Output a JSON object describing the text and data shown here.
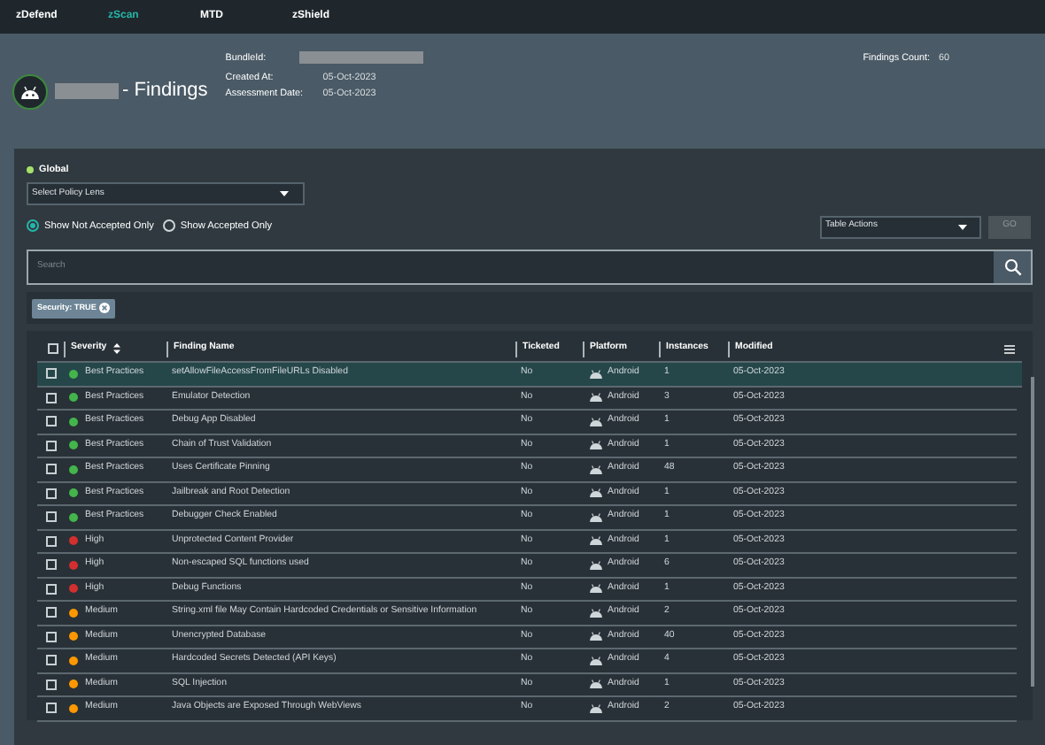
{
  "nav": [
    {
      "label": "zDefend",
      "selected": false
    },
    {
      "label": "zScan",
      "selected": true
    },
    {
      "label": "MTD",
      "selected": false
    },
    {
      "label": "zShield",
      "selected": false
    }
  ],
  "header": {
    "title": "- Findings",
    "meta": [
      {
        "label": "BundleId:",
        "value_redacted": true
      },
      {
        "label": "Created At:",
        "value": "05-Oct-2023"
      },
      {
        "label": "Assessment Date:",
        "value": "05-Oct-2023"
      }
    ],
    "findings_count_label": "Findings Count:",
    "findings_count": "60"
  },
  "scope": {
    "label": "Global",
    "color": "#a5e26a"
  },
  "policy_lens": {
    "placeholder": "Select Policy Lens"
  },
  "radios": [
    {
      "label": "Show Not Accepted Only",
      "selected": true
    },
    {
      "label": "Show Accepted Only",
      "selected": false
    }
  ],
  "table_actions": {
    "placeholder": "Table Actions"
  },
  "go_button": {
    "label": "GO",
    "disabled": true
  },
  "search": {
    "placeholder": "Search"
  },
  "filters": [
    {
      "label": "Security: TRUE"
    }
  ],
  "table": {
    "select_all_checked": false,
    "columns": [
      {
        "label": "Severity",
        "sortable": true
      },
      {
        "label": "Finding Name",
        "sortable": false
      },
      {
        "label": "Ticketed",
        "sortable": false
      },
      {
        "label": "Platform",
        "sortable": false
      },
      {
        "label": "Instances",
        "sortable": false
      },
      {
        "label": "Modified",
        "sortable": false
      }
    ],
    "rows": [
      {
        "severity": "Best Practices",
        "color": "#43b54b",
        "name": "setAllowFileAccessFromFileURLs Disabled",
        "ticketed": "No",
        "platform": "Android",
        "instances": "1",
        "modified": "05-Oct-2023",
        "selected": true,
        "checked": false
      },
      {
        "severity": "Best Practices",
        "color": "#43b54b",
        "name": "Emulator Detection",
        "ticketed": "No",
        "platform": "Android",
        "instances": "3",
        "modified": "05-Oct-2023",
        "selected": false,
        "checked": false
      },
      {
        "severity": "Best Practices",
        "color": "#43b54b",
        "name": "Debug App Disabled",
        "ticketed": "No",
        "platform": "Android",
        "instances": "1",
        "modified": "05-Oct-2023",
        "selected": false,
        "checked": false
      },
      {
        "severity": "Best Practices",
        "color": "#43b54b",
        "name": "Chain of Trust Validation",
        "ticketed": "No",
        "platform": "Android",
        "instances": "1",
        "modified": "05-Oct-2023",
        "selected": false,
        "checked": false
      },
      {
        "severity": "Best Practices",
        "color": "#43b54b",
        "name": "Uses Certificate Pinning",
        "ticketed": "No",
        "platform": "Android",
        "instances": "48",
        "modified": "05-Oct-2023",
        "selected": false,
        "checked": false
      },
      {
        "severity": "Best Practices",
        "color": "#43b54b",
        "name": "Jailbreak and Root Detection",
        "ticketed": "No",
        "platform": "Android",
        "instances": "1",
        "modified": "05-Oct-2023",
        "selected": false,
        "checked": false
      },
      {
        "severity": "Best Practices",
        "color": "#43b54b",
        "name": "Debugger Check Enabled",
        "ticketed": "No",
        "platform": "Android",
        "instances": "1",
        "modified": "05-Oct-2023",
        "selected": false,
        "checked": false
      },
      {
        "severity": "High",
        "color": "#d32f2f",
        "name": "Unprotected Content Provider",
        "ticketed": "No",
        "platform": "Android",
        "instances": "1",
        "modified": "05-Oct-2023",
        "selected": false,
        "checked": false
      },
      {
        "severity": "High",
        "color": "#d32f2f",
        "name": "Non-escaped SQL functions used",
        "ticketed": "No",
        "platform": "Android",
        "instances": "6",
        "modified": "05-Oct-2023",
        "selected": false,
        "checked": false
      },
      {
        "severity": "High",
        "color": "#d32f2f",
        "name": "Debug Functions",
        "ticketed": "No",
        "platform": "Android",
        "instances": "1",
        "modified": "05-Oct-2023",
        "selected": false,
        "checked": false
      },
      {
        "severity": "Medium",
        "color": "#ff9800",
        "name": "String.xml file May Contain Hardcoded Credentials or Sensitive Information",
        "ticketed": "No",
        "platform": "Android",
        "instances": "2",
        "modified": "05-Oct-2023",
        "selected": false,
        "checked": false
      },
      {
        "severity": "Medium",
        "color": "#ff9800",
        "name": "Unencrypted Database",
        "ticketed": "No",
        "platform": "Android",
        "instances": "40",
        "modified": "05-Oct-2023",
        "selected": false,
        "checked": false
      },
      {
        "severity": "Medium",
        "color": "#ff9800",
        "name": "Hardcoded Secrets Detected (API Keys)",
        "ticketed": "No",
        "platform": "Android",
        "instances": "4",
        "modified": "05-Oct-2023",
        "selected": false,
        "checked": false
      },
      {
        "severity": "Medium",
        "color": "#ff9800",
        "name": "SQL Injection",
        "ticketed": "No",
        "platform": "Android",
        "instances": "1",
        "modified": "05-Oct-2023",
        "selected": false,
        "checked": false
      },
      {
        "severity": "Medium",
        "color": "#ff9800",
        "name": "Java Objects are Exposed Through WebViews",
        "ticketed": "No",
        "platform": "Android",
        "instances": "2",
        "modified": "05-Oct-2023",
        "selected": false,
        "checked": false
      }
    ]
  }
}
